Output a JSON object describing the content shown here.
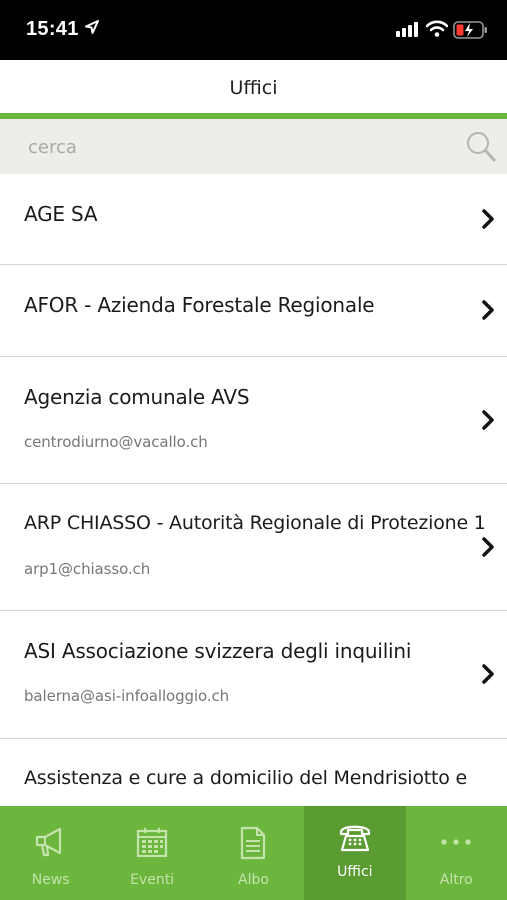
{
  "status_bar": {
    "time": "15:41"
  },
  "header": {
    "title": "Uffici"
  },
  "search": {
    "placeholder": "cerca"
  },
  "offices": [
    {
      "name": "AGE SA",
      "email": ""
    },
    {
      "name": "AFOR - Azienda Forestale Regionale",
      "email": ""
    },
    {
      "name": "Agenzia comunale AVS",
      "email": "centrodiurno@vacallo.ch"
    },
    {
      "name": "ARP CHIASSO - Autorità Regionale di Protezione 1",
      "email": "arp1@chiasso.ch"
    },
    {
      "name": "ASI Associazione svizzera degli inquilini",
      "email": "balerna@asi-infoalloggio.ch"
    },
    {
      "name": "Assistenza e cure a domicilio del Mendrisiotto e",
      "email": ""
    }
  ],
  "tabs": [
    {
      "label": "News",
      "icon": "megaphone-icon"
    },
    {
      "label": "Eventi",
      "icon": "calendar-icon"
    },
    {
      "label": "Albo",
      "icon": "document-icon"
    },
    {
      "label": "Uffici",
      "icon": "telephone-icon",
      "active": true
    },
    {
      "label": "Altro",
      "icon": "more-icon"
    }
  ],
  "colors": {
    "accent": "#6cb63e",
    "accent_active": "#5a9c31",
    "search_bg": "#eceee8"
  }
}
